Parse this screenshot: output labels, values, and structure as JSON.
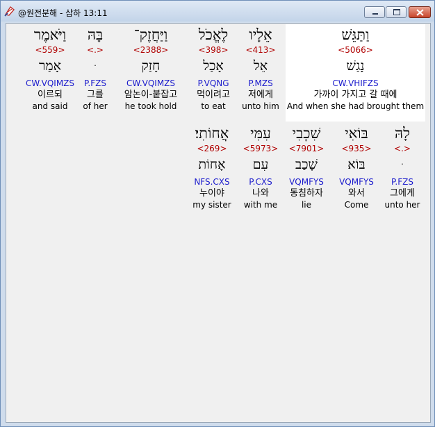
{
  "window": {
    "title": "@원전분해 - 삼하 13:11",
    "controls": {
      "minimize": "minimize-icon",
      "maximize": "maximize-icon",
      "close": "close-icon"
    }
  },
  "rows": [
    [
      {
        "heb": "וַיֹּאמֶר",
        "strong": "<559>",
        "lemma": "אָמַר",
        "morph": "CW.VQIMZS",
        "kor": "이르되",
        "eng": "and said"
      },
      {
        "heb": "בָּהּ",
        "strong": "<.>",
        "lemma": "ּ",
        "morph": "P.FZS",
        "kor": "그를",
        "eng": "of her"
      },
      {
        "heb": "וַיַּחֲזֶק־",
        "strong": "<2388>",
        "lemma": "חָזַק",
        "morph": "CW.VQIMZS",
        "kor": "암논이-붙잡고",
        "eng": "he took hold"
      },
      {
        "heb": "לֶאֱכֹל",
        "strong": "<398>",
        "lemma": "אָכַל",
        "morph": "P.VQNG",
        "kor": "먹이려고",
        "eng": "to eat"
      },
      {
        "heb": "אֵלָיו",
        "strong": "<413>",
        "lemma": "אֵל",
        "morph": "P.MZS",
        "kor": "저에게",
        "eng": "unto him"
      },
      {
        "heb": "וַתַּגֵּשׁ",
        "strong": "<5066>",
        "lemma": "נָגַשׁ",
        "morph": "CW.VHIFZS",
        "kor": "가까이 가지고 갈 때에",
        "eng": "And when she had brought them"
      }
    ],
    [
      {
        "heb": "אֲחוֹתִי׃",
        "strong": "<269>",
        "lemma": "אָחוֹת",
        "morph": "NFS.CXS",
        "kor": "누이야",
        "eng": "my sister"
      },
      {
        "heb": "עִמִּי",
        "strong": "<5973>",
        "lemma": "עִם",
        "morph": "P.CXS",
        "kor": "나와",
        "eng": "with me"
      },
      {
        "heb": "שִׁכְבִי",
        "strong": "<7901>",
        "lemma": "שָׁכַב",
        "morph": "VQMFYS",
        "kor": "동침하자",
        "eng": "lie"
      },
      {
        "heb": "בּוֹאִי",
        "strong": "<935>",
        "lemma": "בּוֹא",
        "morph": "VQMFYS",
        "kor": "와서",
        "eng": "Come"
      },
      {
        "heb": "לָהּ",
        "strong": "<.>",
        "lemma": "ּ",
        "morph": "P.FZS",
        "kor": "그에게",
        "eng": "unto her"
      }
    ]
  ]
}
